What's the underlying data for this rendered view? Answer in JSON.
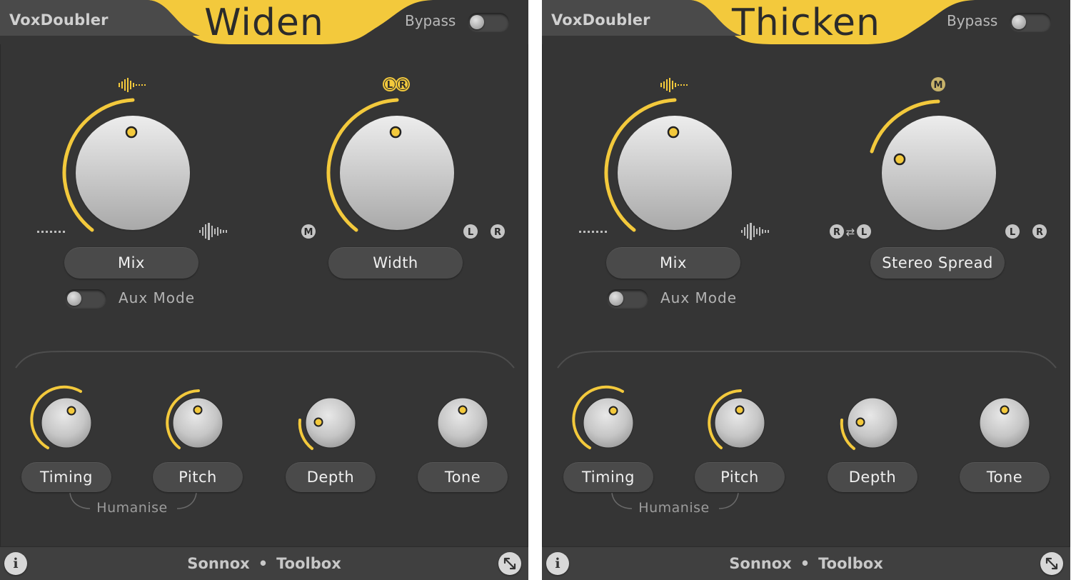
{
  "colors": {
    "accent": "#f3c93c",
    "panel": "#353535",
    "knob_light": "#e4e4e4",
    "badge": "#c5c5c5"
  },
  "panels": [
    {
      "brand": "VoxDoubler",
      "mode_title": "Widen",
      "bypass_label": "Bypass",
      "mix_label": "Mix",
      "aux_label": "Aux Mode",
      "right_knob_label": "Width",
      "right_knob_top_badges": [
        "L",
        "R"
      ],
      "right_knob_left_badges": [
        "M"
      ],
      "right_knob_right_badges": [
        "L",
        "R"
      ],
      "timing_label": "Timing",
      "pitch_label": "Pitch",
      "depth_label": "Depth",
      "tone_label": "Tone",
      "humanise_label": "Humanise",
      "footer_brand": "Sonnox",
      "footer_dot": "•",
      "footer_product": "Toolbox",
      "info_label": "i"
    },
    {
      "brand": "VoxDoubler",
      "mode_title": "Thicken",
      "bypass_label": "Bypass",
      "mix_label": "Mix",
      "aux_label": "Aux Mode",
      "right_knob_label": "Stereo Spread",
      "right_knob_top_badges": [
        "M"
      ],
      "right_knob_left_badges": [
        "R",
        "⇄",
        "L"
      ],
      "right_knob_right_badges": [
        "L",
        "R"
      ],
      "timing_label": "Timing",
      "pitch_label": "Pitch",
      "depth_label": "Depth",
      "tone_label": "Tone",
      "humanise_label": "Humanise",
      "footer_brand": "Sonnox",
      "footer_dot": "•",
      "footer_product": "Toolbox",
      "info_label": "i"
    }
  ],
  "icons": {
    "mix_top": "waveform-small-icon",
    "mix_left": "dotted-line-icon",
    "mix_right": "waveform-large-icon",
    "resize": "resize-arrows-icon",
    "info": "info-icon"
  }
}
